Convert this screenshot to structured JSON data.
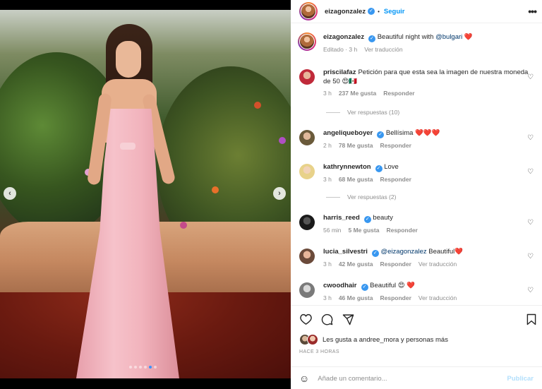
{
  "header": {
    "username": "eizagonzalez",
    "verified_glyph": "✓",
    "separator": "•",
    "follow_label": "Seguir",
    "more_icon": "more-horizontal-icon"
  },
  "caption": {
    "username": "eizagonzalez",
    "text": "Beautiful night with",
    "mention": "@bulgari",
    "time": "Editado · 3 h",
    "translate": "Ver traducción"
  },
  "comments": [
    {
      "username": "priscilafaz",
      "text": "Petición para que esta sea la imagen de nuestra moneda de 50 😍🇲🇽",
      "time": "3 h",
      "likes": "237 Me gusta",
      "reply": "Responder",
      "view_replies": "Ver respuestas (10)"
    },
    {
      "username": "angeliqueboyer",
      "text": "Bellísima ❤️❤️❤️",
      "time": "2 h",
      "likes": "78 Me gusta",
      "reply": "Responder"
    },
    {
      "username": "kathrynnewton",
      "text": "Love",
      "time": "3 h",
      "likes": "68 Me gusta",
      "reply": "Responder",
      "view_replies": "Ver respuestas (2)"
    },
    {
      "username": "harris_reed",
      "text": "beauty",
      "time": "56 min",
      "likes": "5 Me gusta",
      "reply": "Responder"
    },
    {
      "username": "lucia_silvestri",
      "mention": "@eizagonzalez",
      "text": "Beautiful❤️",
      "time": "3 h",
      "likes": "42 Me gusta",
      "reply": "Responder",
      "translate": "Ver traducción"
    },
    {
      "username": "cwoodhair",
      "text": "Beautiful 😍 ❤️",
      "time": "3 h",
      "likes": "46 Me gusta",
      "reply": "Responder",
      "translate": "Ver traducción"
    }
  ],
  "likes_text": "Les gusta a andree_mora y personas más",
  "time_ago": "HACE 3 HORAS",
  "composer": {
    "placeholder": "Añade un comentario...",
    "publish_label": "Publicar"
  },
  "colors": {
    "link": "#0095f6",
    "verified": "#3897f0",
    "muted": "#8e8e8e",
    "heart": "#e0245e"
  },
  "carousel": {
    "slide_count": 6,
    "active_index": 4
  }
}
